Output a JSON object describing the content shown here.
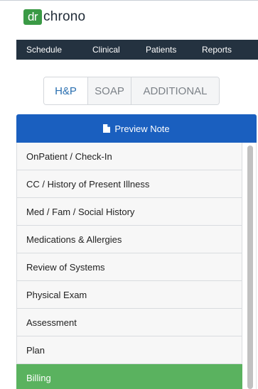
{
  "app": {
    "logo_badge": "dr",
    "logo_word": "chrono"
  },
  "nav": {
    "items": [
      "Schedule",
      "Clinical",
      "Patients",
      "Reports"
    ]
  },
  "tabs": [
    {
      "label": "H&P",
      "active": true
    },
    {
      "label": "SOAP",
      "active": false
    },
    {
      "label": "ADDITIONAL",
      "active": false
    }
  ],
  "preview": {
    "label": "Preview Note",
    "icon": "document-icon"
  },
  "sections": [
    {
      "label": "OnPatient / Check-In",
      "active": false
    },
    {
      "label": "CC / History of Present Illness",
      "active": false
    },
    {
      "label": "Med / Fam / Social History",
      "active": false
    },
    {
      "label": "Medications & Allergies",
      "active": false
    },
    {
      "label": "Review of Systems",
      "active": false
    },
    {
      "label": "Physical Exam",
      "active": false
    },
    {
      "label": "Assessment",
      "active": false
    },
    {
      "label": "Plan",
      "active": false
    },
    {
      "label": "Billing",
      "active": true
    }
  ],
  "colors": {
    "brand_green": "#3a9a45",
    "navbar": "#243240",
    "primary_blue": "#1a5fbf",
    "active_green": "#5ab25f",
    "tab_active_text": "#2a6fb0"
  }
}
